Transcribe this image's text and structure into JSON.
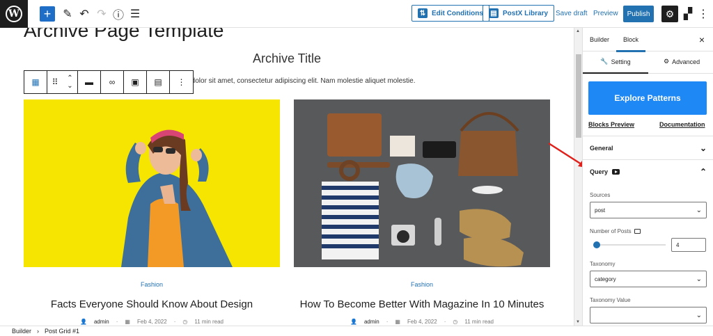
{
  "toolbar": {
    "add_icon": "+",
    "edit_conditions_label": "Edit Conditions",
    "postx_library_label": "PostX Library",
    "save_draft_label": "Save draft",
    "preview_label": "Preview",
    "publish_label": "Publish"
  },
  "canvas": {
    "page_heading": "Archive Page Template",
    "archive_title": "Archive Title",
    "archive_description": "um dolor sit amet, consectetur adipiscing elit. Nam molestie aliquet molestie.",
    "posts": [
      {
        "category": "Fashion",
        "title": "Facts Everyone Should Know About Design",
        "author": "admin",
        "date": "Feb 4, 2022",
        "read_time": "11 min read"
      },
      {
        "category": "Fashion",
        "title": "How To Become Better With Magazine In 10 Minutes",
        "author": "admin",
        "date": "Feb 4, 2022",
        "read_time": "11 min read"
      }
    ]
  },
  "sidebar": {
    "tabs": [
      "Builder",
      "Block"
    ],
    "active_tab": "Block",
    "sub_tabs": [
      "Setting",
      "Advanced"
    ],
    "explore_patterns_label": "Explore Patterns",
    "blocks_preview_label": "Blocks Preview",
    "documentation_label": "Documentation",
    "general_label": "General",
    "query_label": "Query",
    "sources_label": "Sources",
    "sources_value": "post",
    "number_of_posts_label": "Number of Posts",
    "number_of_posts_value": "4",
    "number_of_posts_slider_fraction": 0.04,
    "taxonomy_label": "Taxonomy",
    "taxonomy_value": "category",
    "taxonomy_value_label": "Taxonomy Value",
    "taxonomy_value_value": ""
  },
  "footer": {
    "breadcrumb": [
      "Builder",
      "Post Grid #1"
    ]
  },
  "colors": {
    "accent": "#2271b1",
    "explore_button": "#1e88f5",
    "annotation_arrow": "#e0201b"
  }
}
